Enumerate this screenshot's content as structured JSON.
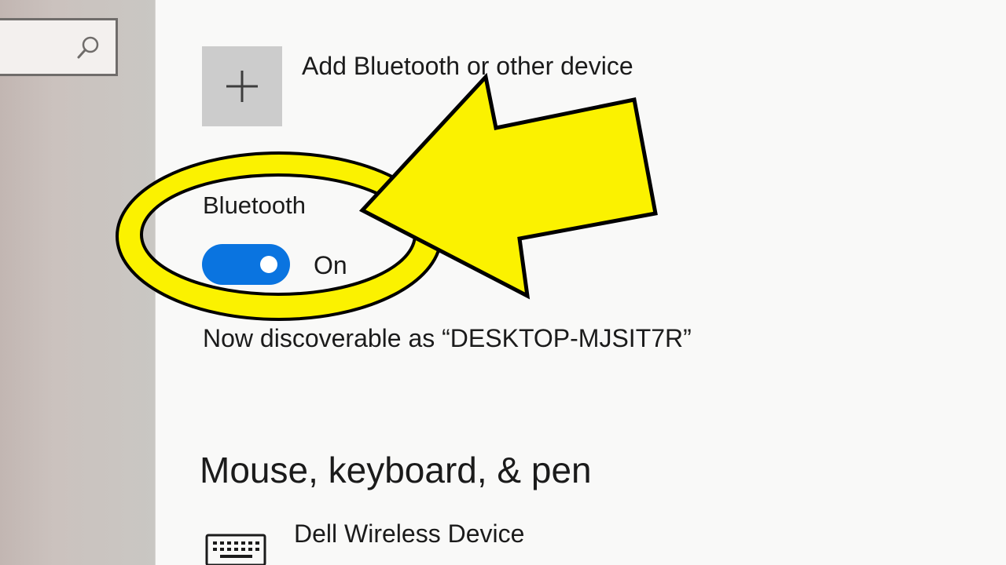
{
  "sidebar": {
    "search_icon": "search-icon"
  },
  "main": {
    "add_device": {
      "icon": "plus-icon",
      "label": "Add Bluetooth or other device"
    },
    "bluetooth": {
      "label": "Bluetooth",
      "toggle_state": "On",
      "toggle_on": true,
      "discoverable_text": "Now discoverable as “DESKTOP-MJSIT7R”"
    },
    "section": {
      "heading": "Mouse, keyboard, & pen"
    },
    "devices": [
      {
        "name": "Dell Wireless Device",
        "icon": "keyboard-icon"
      }
    ]
  },
  "annotation": {
    "highlight_color": "#fbf200",
    "outline_color": "#000000"
  },
  "colors": {
    "accent": "#0a74e0",
    "background": "#f9f9f8",
    "tile": "#cccccc"
  }
}
